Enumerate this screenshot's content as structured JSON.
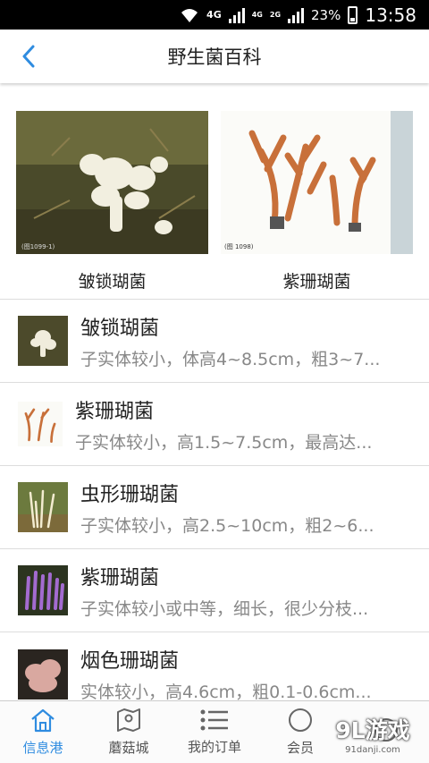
{
  "status": {
    "network1": "4G",
    "network2": "4G",
    "network3": "2G",
    "battery": "23%",
    "time": "13:58"
  },
  "header": {
    "title": "野生菌百科"
  },
  "featured": [
    {
      "caption": "皱锁瑚菌",
      "photo_label": "(图1099-1)"
    },
    {
      "caption": "紫珊瑚菌",
      "photo_label": "(图 1098)"
    }
  ],
  "items": [
    {
      "title": "皱锁瑚菌",
      "desc": "子实体较小，体高4~8.5cm，粗3~7..."
    },
    {
      "title": "紫珊瑚菌",
      "desc": "子实体较小，高1.5~7.5cm，最高达..."
    },
    {
      "title": "虫形珊瑚菌",
      "desc": "子实体较小，高2.5~10cm，粗2~6..."
    },
    {
      "title": "紫珊瑚菌",
      "desc": "子实体较小或中等，细长，很少分枝..."
    },
    {
      "title": "烟色珊瑚菌",
      "desc": "实体较小，高4.6cm，粗0.1-0.6cm..."
    }
  ],
  "tabs": [
    {
      "label": "信息港",
      "icon": "home-icon",
      "active": true
    },
    {
      "label": "蘑菇城",
      "icon": "map-icon"
    },
    {
      "label": "我的订单",
      "icon": "list-icon"
    },
    {
      "label": "会员",
      "icon": "user-icon"
    }
  ],
  "watermark": {
    "logo": "9L游戏",
    "url": "91danji.com"
  },
  "colors": {
    "accent": "#2f8ce0"
  }
}
